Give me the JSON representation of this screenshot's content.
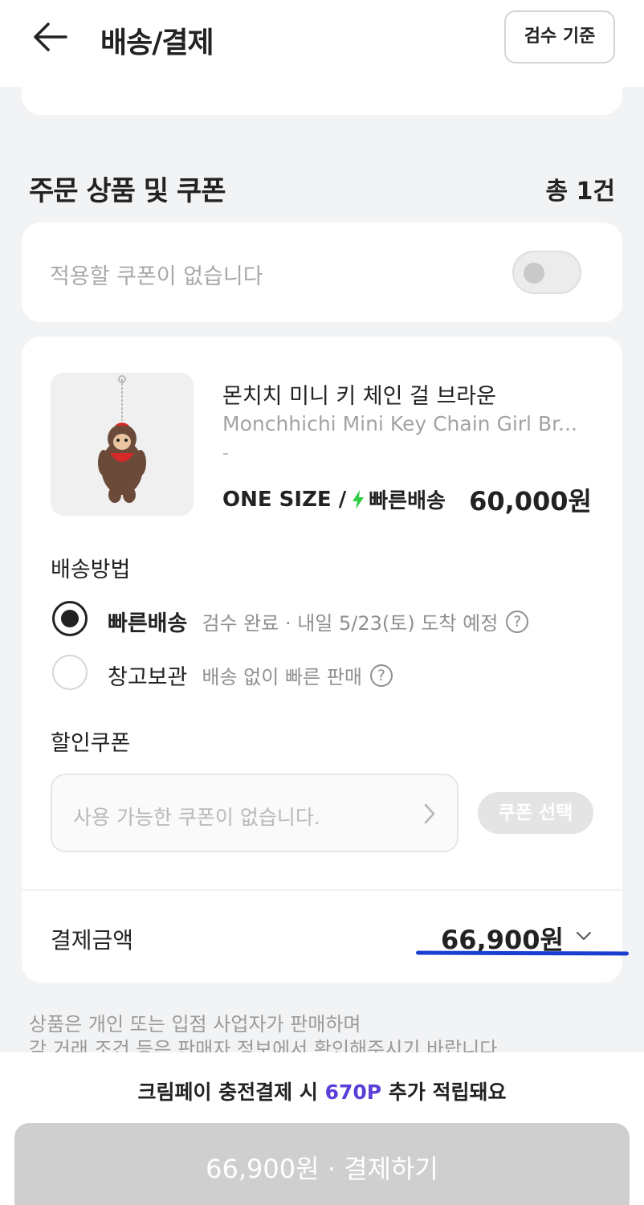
{
  "header": {
    "title": "배송/결제",
    "inspect_button": "검수 기준"
  },
  "order_section": {
    "title": "주문 상품 및 쿠폰",
    "count": "총 1건"
  },
  "coupon_toggle": {
    "text": "적용할 쿠폰이 없습니다",
    "enabled": false
  },
  "product": {
    "name_ko": "몬치치 미니 키 체인 걸 브라운",
    "name_en": "Monchhichi Mini Key Chain Girl Br...",
    "dash": "-",
    "option": "ONE SIZE /",
    "shipping_tag": "빠른배송",
    "price": "60,000원"
  },
  "shipping": {
    "label": "배송방법",
    "options": [
      {
        "name": "빠른배송",
        "desc": "검수 완료 · 내일 5/23(토) 도착 예정",
        "selected": true
      },
      {
        "name": "창고보관",
        "desc": "배송 없이 빠른 판매",
        "selected": false
      }
    ],
    "help": "?"
  },
  "discount": {
    "label": "할인쿠폰",
    "placeholder": "사용 가능한 쿠폰이 없습니다.",
    "select_button": "쿠폰 선택"
  },
  "payment": {
    "label": "결제금액",
    "amount": "66,900원"
  },
  "notice": {
    "line1": "상품은 개인 또는 입점 사업자가 판매하며",
    "line2": "각 거래 조건 등은 판매자 정보에서 확인해주시기 바랍니다"
  },
  "footer": {
    "promo_prefix": "크림페이 충전결제 시 ",
    "promo_points": "670P",
    "promo_suffix": " 추가 적립돼요",
    "pay_button": "66,900원 · 결제하기"
  },
  "colors": {
    "accent_points": "#5b3fd6",
    "underline": "#1a3fd0",
    "bolt": "#2ecc40"
  }
}
